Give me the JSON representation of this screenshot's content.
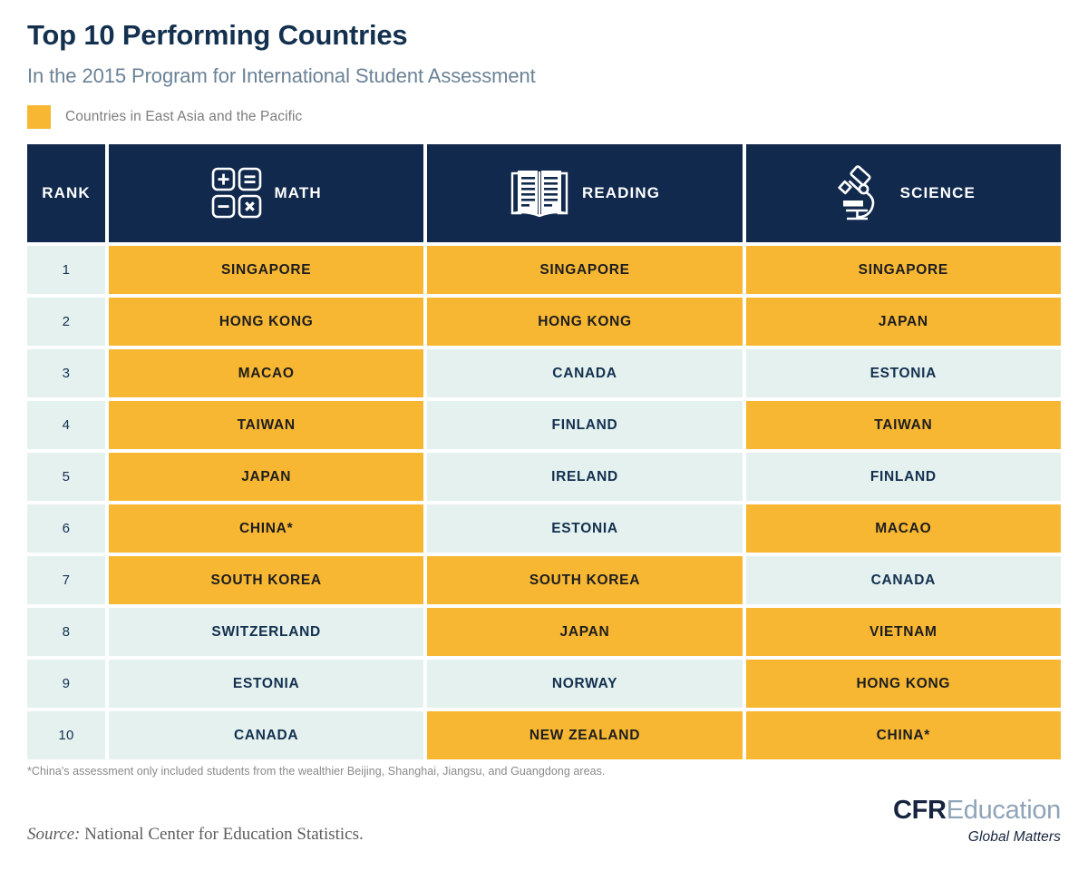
{
  "header": {
    "title": "Top 10 Performing Countries",
    "subtitle": "In the 2015 Program for International Student Assessment",
    "legend": {
      "label": "Countries in East Asia and the Pacific",
      "swatch_color": "#f7b733"
    }
  },
  "colors": {
    "header_navy": "#10294d",
    "highlight_orange": "#f7b733",
    "plain_mint": "#e4f1ef",
    "title_navy": "#13304f",
    "subtitle_slate": "#6b8296"
  },
  "table": {
    "columns": [
      {
        "key": "rank",
        "label": "RANK",
        "icon": null
      },
      {
        "key": "math",
        "label": "MATH",
        "icon": "calculator-icon"
      },
      {
        "key": "reading",
        "label": "READING",
        "icon": "open-book-icon"
      },
      {
        "key": "science",
        "label": "SCIENCE",
        "icon": "microscope-icon"
      }
    ],
    "rows": [
      {
        "rank": "1",
        "math": {
          "country": "SINGAPORE",
          "highlight": true
        },
        "reading": {
          "country": "SINGAPORE",
          "highlight": true
        },
        "science": {
          "country": "SINGAPORE",
          "highlight": true
        }
      },
      {
        "rank": "2",
        "math": {
          "country": "HONG KONG",
          "highlight": true
        },
        "reading": {
          "country": "HONG KONG",
          "highlight": true
        },
        "science": {
          "country": "JAPAN",
          "highlight": true
        }
      },
      {
        "rank": "3",
        "math": {
          "country": "MACAO",
          "highlight": true
        },
        "reading": {
          "country": "CANADA",
          "highlight": false
        },
        "science": {
          "country": "ESTONIA",
          "highlight": false
        }
      },
      {
        "rank": "4",
        "math": {
          "country": "TAIWAN",
          "highlight": true
        },
        "reading": {
          "country": "FINLAND",
          "highlight": false
        },
        "science": {
          "country": "TAIWAN",
          "highlight": true
        }
      },
      {
        "rank": "5",
        "math": {
          "country": "JAPAN",
          "highlight": true
        },
        "reading": {
          "country": "IRELAND",
          "highlight": false
        },
        "science": {
          "country": "FINLAND",
          "highlight": false
        }
      },
      {
        "rank": "6",
        "math": {
          "country": "CHINA*",
          "highlight": true
        },
        "reading": {
          "country": "ESTONIA",
          "highlight": false
        },
        "science": {
          "country": "MACAO",
          "highlight": true
        }
      },
      {
        "rank": "7",
        "math": {
          "country": "SOUTH KOREA",
          "highlight": true
        },
        "reading": {
          "country": "SOUTH KOREA",
          "highlight": true
        },
        "science": {
          "country": "CANADA",
          "highlight": false
        }
      },
      {
        "rank": "8",
        "math": {
          "country": "SWITZERLAND",
          "highlight": false
        },
        "reading": {
          "country": "JAPAN",
          "highlight": true
        },
        "science": {
          "country": "VIETNAM",
          "highlight": true
        }
      },
      {
        "rank": "9",
        "math": {
          "country": "ESTONIA",
          "highlight": false
        },
        "reading": {
          "country": "NORWAY",
          "highlight": false
        },
        "science": {
          "country": "HONG KONG",
          "highlight": true
        }
      },
      {
        "rank": "10",
        "math": {
          "country": "CANADA",
          "highlight": false
        },
        "reading": {
          "country": "NEW ZEALAND",
          "highlight": true
        },
        "science": {
          "country": "CHINA*",
          "highlight": true
        }
      }
    ]
  },
  "footnote": "*China's assessment only included students from the wealthier Beijing, Shanghai, Jiangsu, and Guangdong areas.",
  "source": {
    "label": "Source:",
    "text": "National Center for Education Statistics."
  },
  "logo": {
    "primary": "CFR",
    "secondary": "Education",
    "tagline": "Global Matters"
  }
}
